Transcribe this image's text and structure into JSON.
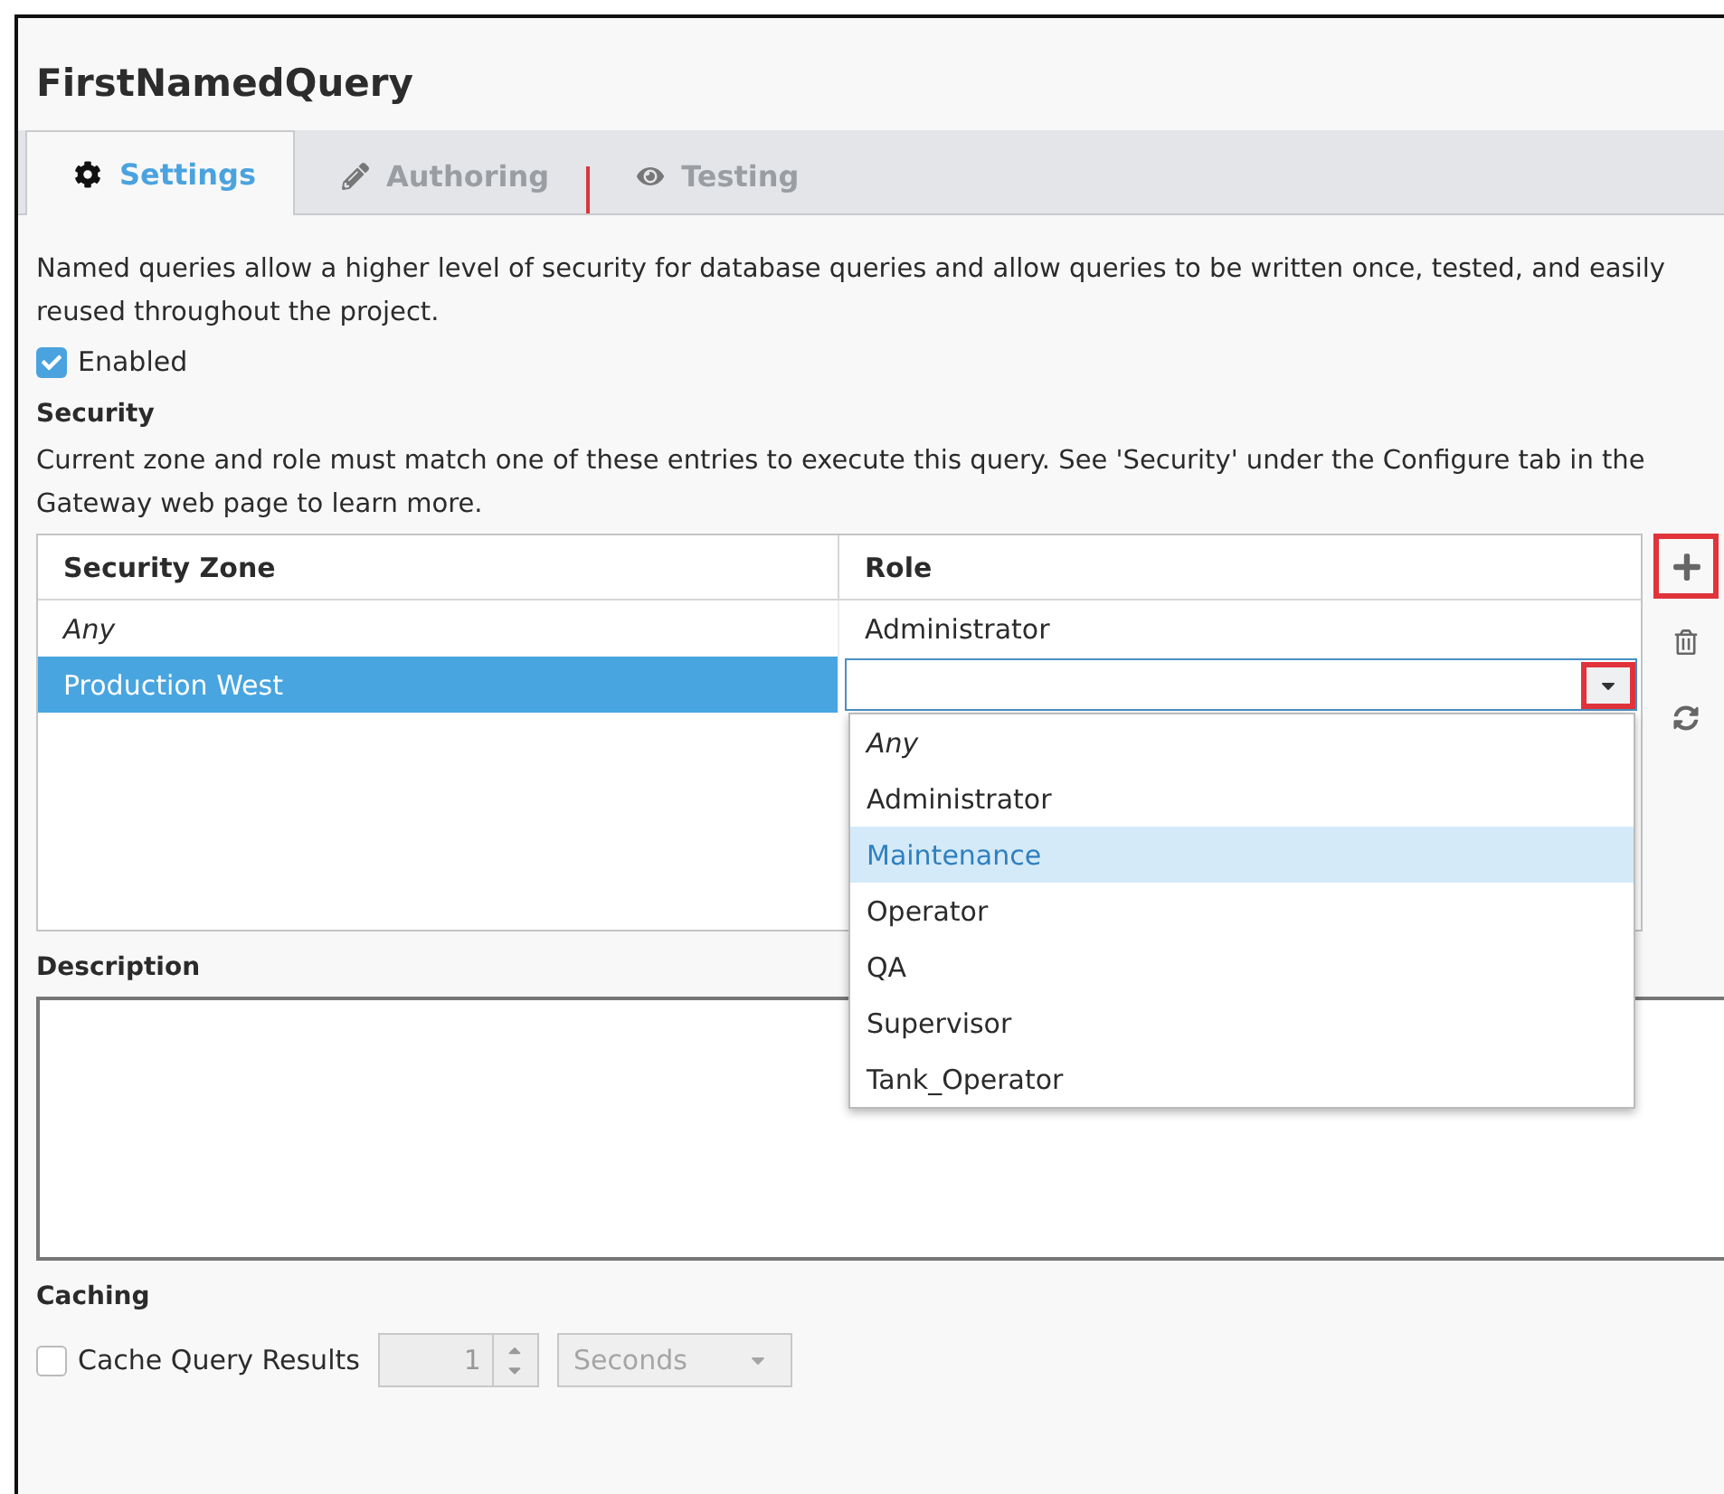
{
  "title": "FirstNamedQuery",
  "tabs": [
    {
      "label": "Settings",
      "selected": true,
      "marked": false
    },
    {
      "label": "Authoring",
      "selected": false,
      "marked": true
    },
    {
      "label": "Testing",
      "selected": false,
      "marked": false
    }
  ],
  "intro": "Named queries allow a higher level of security for database queries and allow queries to be written once, tested, and easily reused throughout the project.",
  "enabled": {
    "label": "Enabled",
    "checked": true
  },
  "security": {
    "heading": "Security",
    "note": "Current zone and role must match one of these entries to execute this query. See 'Security' under the Configure tab in the Gateway web page to learn more.",
    "columns": [
      "Security Zone",
      "Role"
    ],
    "rows": [
      {
        "zone": "Any",
        "italic": true,
        "role": "Administrator",
        "selected": false,
        "editing": false
      },
      {
        "zone": "Production West",
        "italic": false,
        "role": "",
        "selected": true,
        "editing": true
      }
    ],
    "arrow_highlighted": true,
    "actions": [
      {
        "highlighted": true
      },
      {
        "highlighted": false
      },
      {
        "highlighted": false
      }
    ],
    "options": [
      {
        "label": "Any",
        "italic": true,
        "selected": false
      },
      {
        "label": "Administrator",
        "italic": false,
        "selected": false
      },
      {
        "label": "Maintenance",
        "italic": false,
        "selected": true
      },
      {
        "label": "Operator",
        "italic": false,
        "selected": false
      },
      {
        "label": "QA",
        "italic": false,
        "selected": false
      },
      {
        "label": "Supervisor",
        "italic": false,
        "selected": false
      },
      {
        "label": "Tank_Operator",
        "italic": false,
        "selected": false
      }
    ]
  },
  "description": {
    "heading": "Description"
  },
  "caching": {
    "heading": "Caching",
    "label": "Cache Query Results",
    "checked": false,
    "amount": "1",
    "unit": "Seconds",
    "disabled": true
  }
}
